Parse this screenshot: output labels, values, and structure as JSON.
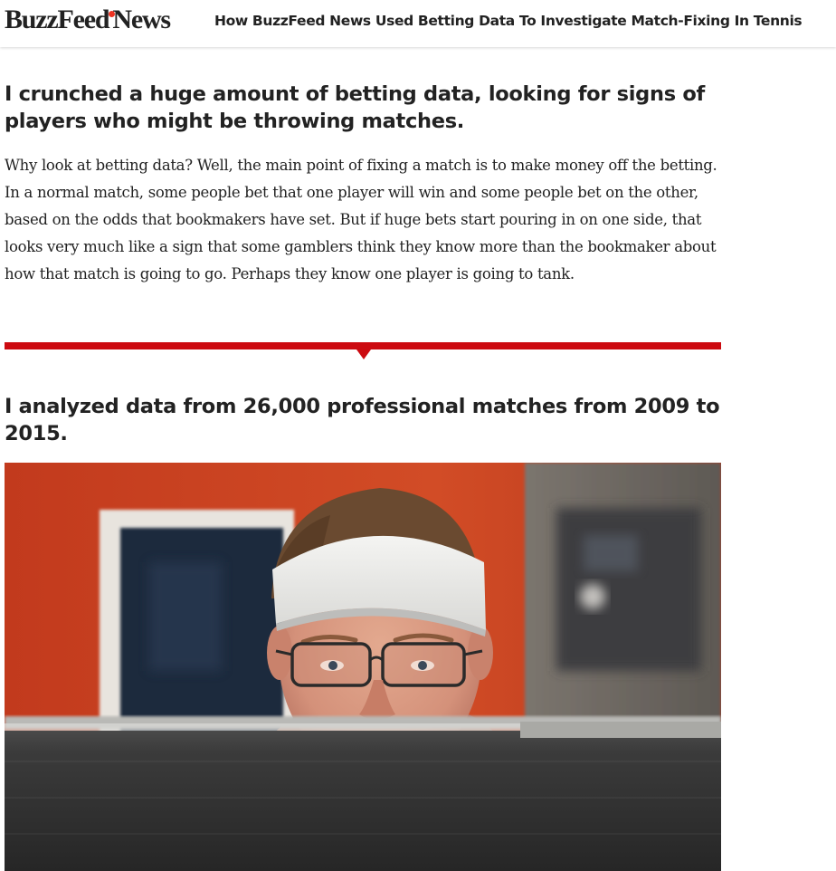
{
  "header": {
    "logo_main": "BuzzFeed",
    "logo_sub": "News",
    "article_title": "How BuzzFeed News Used Betting Data To Investigate Match-Fixing In Tennis"
  },
  "article": {
    "heading_1": "I crunched a huge amount of betting data, looking for signs of players who might be throwing matches.",
    "paragraph_1": "Why look at betting data? Well, the main point of fixing a match is to make money off the betting. In a normal match, some people bet that one player will win and some people bet on the other, based on the odds that bookmakers have set. But if huge bets start pouring in on one side, that looks very much like a sign that some gamblers think they know more than the bookmaker about how that match is going to go. Perhaps they know one player is going to tank.",
    "heading_2": "I analyzed data from 26,000 professional matches from 2009 to 2015."
  },
  "colors": {
    "divider": "#cc0a10",
    "logo_dot": "#e32",
    "text": "#222222",
    "photo_background_red": "#c8401f"
  }
}
